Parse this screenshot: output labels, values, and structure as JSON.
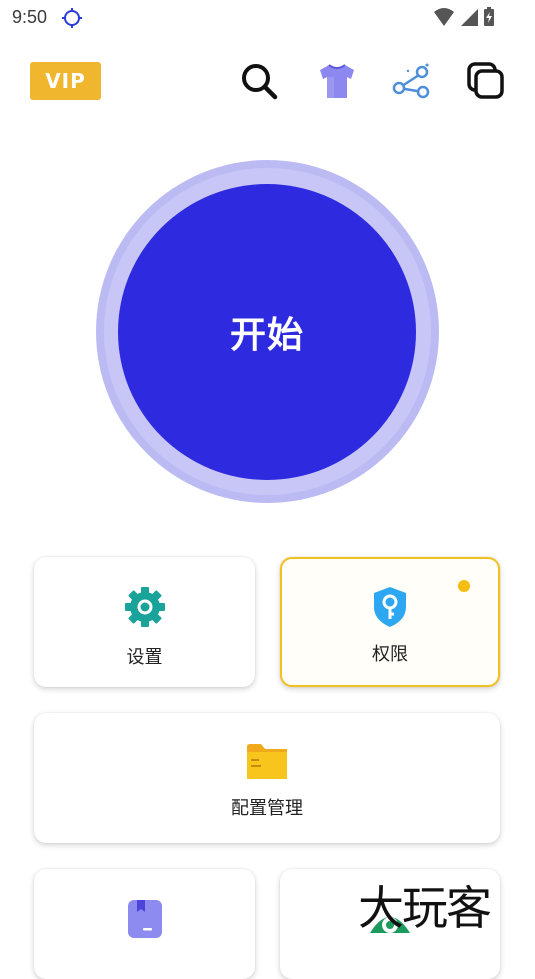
{
  "status_bar": {
    "time": "9:50"
  },
  "header": {
    "vip_label": "VIP"
  },
  "start_button": {
    "label": "开始"
  },
  "cards": {
    "settings": {
      "label": "设置"
    },
    "permissions": {
      "label": "权限"
    },
    "config_manage": {
      "label": "配置管理"
    }
  },
  "watermark": {
    "text": "大玩客"
  },
  "colors": {
    "primary": "#2d2adf",
    "vip": "#f0b62d",
    "settings_icon": "#1aa39b",
    "permission_icon": "#2ea7f2",
    "highlight_border": "#f3c11f",
    "folder": "#f7c11c"
  }
}
